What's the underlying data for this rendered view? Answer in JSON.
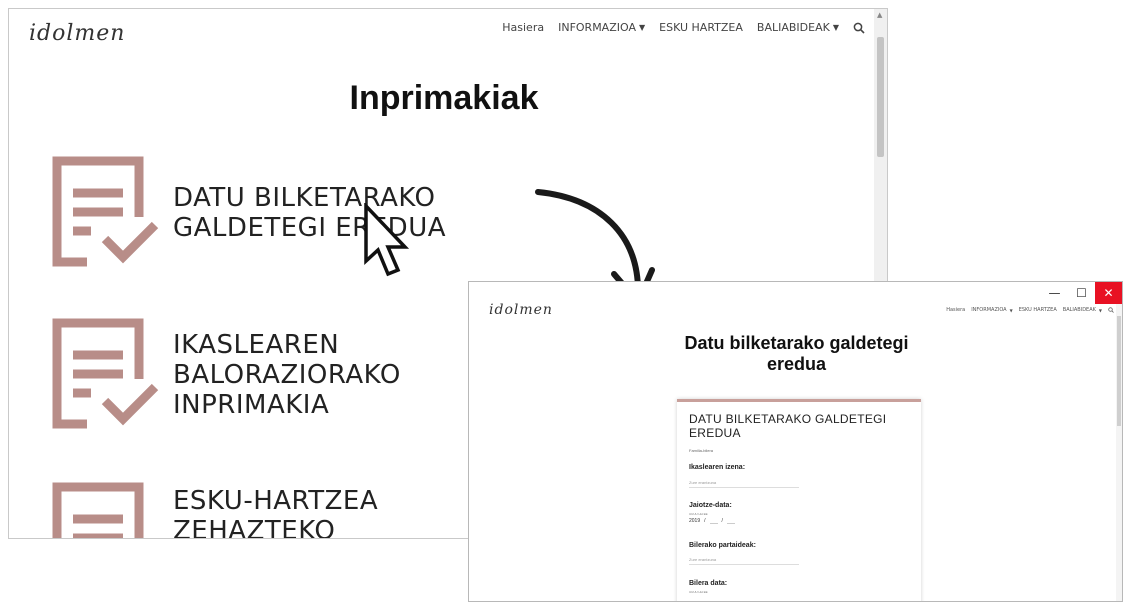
{
  "back_window": {
    "logo": "idolmen",
    "nav": {
      "home": "Hasiera",
      "info": "INFORMAZIOA",
      "intervention": "ESKU HARTZEA",
      "resources": "BALIABIDEAK"
    },
    "page_title": "Inprimakiak",
    "forms": [
      {
        "lines": [
          "DATU BILKETARAKO",
          "GALDETEGI EREDUA"
        ]
      },
      {
        "lines": [
          "IKASLEAREN",
          "BALORAZIORAKO",
          "INPRIMAKIA"
        ]
      },
      {
        "lines": [
          "ESKU-HARTZEA",
          "ZEHAZTEKO"
        ]
      }
    ]
  },
  "front_window": {
    "controls": {
      "minimize": "—",
      "maximize": "☐",
      "close": "✕"
    },
    "logo": "idolmen",
    "nav": {
      "home": "Hasiera",
      "info": "INFORMAZIOA",
      "intervention": "ESKU HARTZEA",
      "resources": "BALIABIDEAK"
    },
    "title_line1": "Datu bilketarako galdetegi",
    "title_line2": "eredua",
    "card": {
      "title": "DATU BILKETARAKO GALDETEGI EREDUA",
      "hint": "Familia-bilera",
      "student_name_label": "Ikaslearen izena:",
      "student_name_placeholder": "Zure erantzuna",
      "birth_date_label": "Jaiotze-data:",
      "date_sub": "UUUU   HH   EE",
      "birth_year": "2019",
      "participants_label": "Bilerako partaideak:",
      "participants_placeholder": "Zure erantzuna",
      "meeting_date_label": "Bilera data:",
      "meeting_date_sub": "UUUU   HH   EE"
    }
  },
  "colors": {
    "icon_rose": "#b88d88",
    "close_red": "#e81123"
  },
  "icons": [
    "search-icon",
    "document-check-icon",
    "mouse-cursor-icon",
    "curved-arrow-icon"
  ]
}
